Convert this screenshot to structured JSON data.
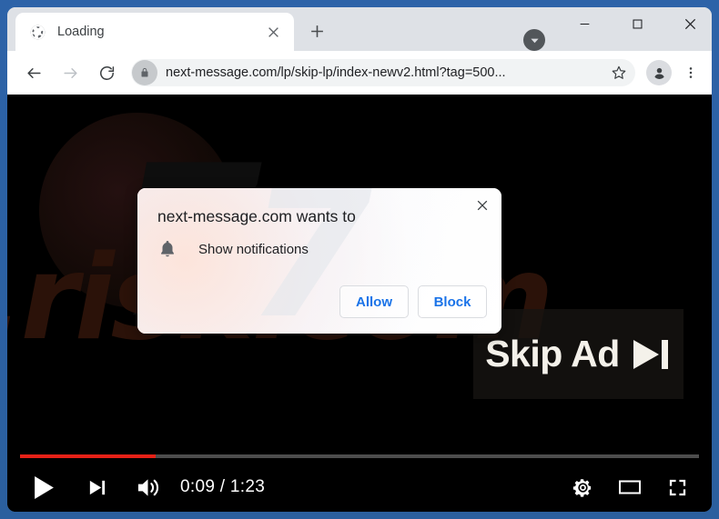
{
  "window": {
    "frame_color": "#2b5f9e",
    "controls": {
      "tab_search_label": "tab-search",
      "minimize_label": "Minimize",
      "maximize_label": "Maximize",
      "close_label": "Close"
    }
  },
  "browser": {
    "tab": {
      "title": "Loading",
      "favicon": "globe-icon",
      "close_label": "Close tab"
    },
    "new_tab_label": "New Tab",
    "toolbar": {
      "back_label": "Back",
      "forward_label": "Forward",
      "reload_label": "Reload",
      "lock_icon": "lock-icon",
      "url_domain": "next-message.com",
      "url_path": "/lp/skip-lp/index-newv2.html?tag=500...",
      "url_full": "next-message.com/lp/skip-lp/index-newv2.html?tag=500...",
      "bookmark_label": "Bookmark this tab",
      "profile_label": "Profile",
      "menu_label": "Customize and control Google Chrome"
    }
  },
  "dialog": {
    "title": "next-message.com wants to",
    "permission": "Show notifications",
    "permission_icon": "bell-icon",
    "allow_label": "Allow",
    "block_label": "Block",
    "close_label": "Close",
    "accent_color": "#1a73e8"
  },
  "page": {
    "watermark_text": ".risk.com",
    "watermark_logo": "7",
    "skip_ad": {
      "label": "Skip Ad",
      "icon": "skip-next-icon"
    }
  },
  "video_controls": {
    "play_label": "Play",
    "next_label": "Next",
    "volume_label": "Mute",
    "current_time": "0:09",
    "duration": "1:23",
    "time_display": "0:09 / 1:23",
    "progress_percent": 20,
    "progress_color": "#e62117",
    "settings_label": "Settings",
    "theater_label": "Theater mode",
    "fullscreen_label": "Full screen"
  }
}
